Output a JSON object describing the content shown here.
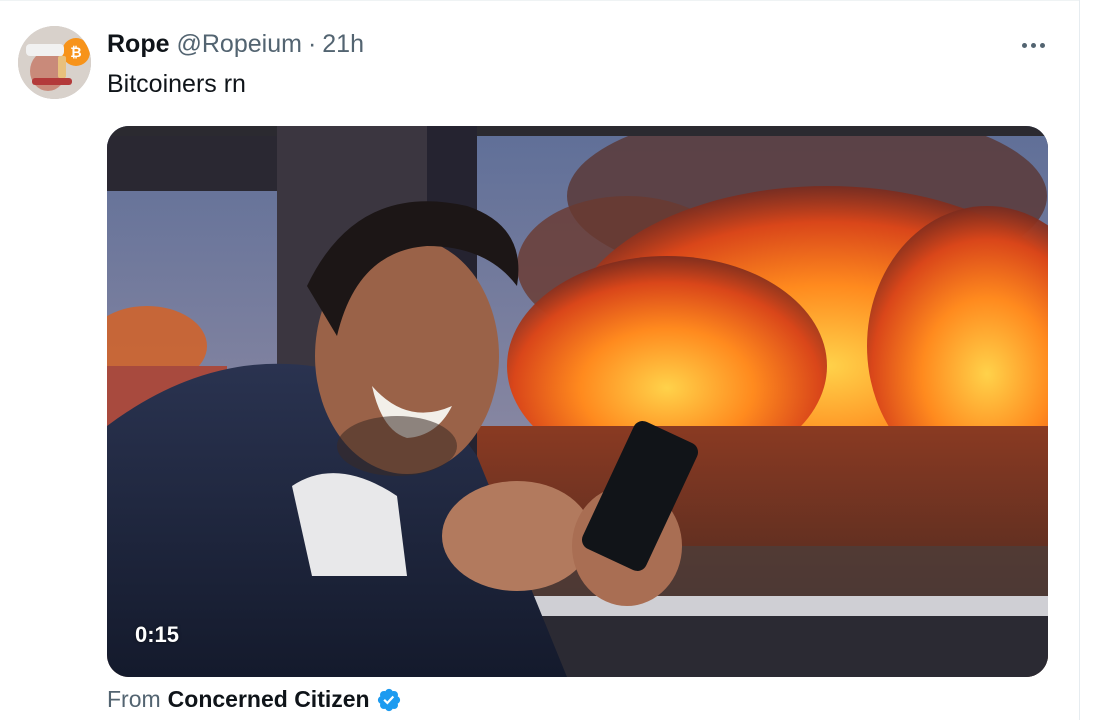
{
  "tweet": {
    "author_name": "Rope",
    "author_handle": "@Ropeium",
    "separator": "·",
    "time": "21h",
    "text": "Bitcoiners rn"
  },
  "media": {
    "duration": "0:15"
  },
  "source": {
    "prefix": "From",
    "name": "Concerned Citizen"
  },
  "icons": {
    "more": "more-horizontal-icon",
    "verified": "verified-badge-icon"
  },
  "colors": {
    "secondary_text": "#536471",
    "primary_text": "#0f1419",
    "verified_blue": "#1d9bf0"
  }
}
